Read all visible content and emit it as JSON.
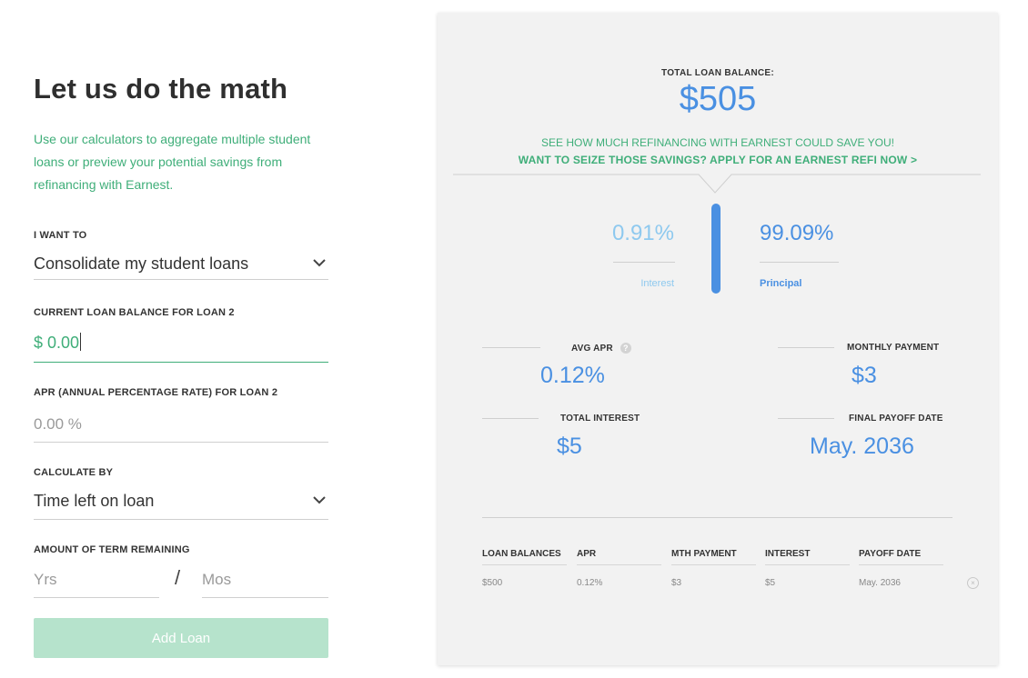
{
  "form": {
    "title": "Let us do the math",
    "intro": "Use our calculators to aggregate multiple student loans or preview your potential savings from refinancing with Earnest.",
    "i_want_to_label": "I WANT TO",
    "i_want_to_value": "Consolidate my student loans",
    "balance_label": "CURRENT LOAN BALANCE FOR LOAN 2",
    "balance_value": "$ 0.00",
    "apr_label": "APR (ANNUAL PERCENTAGE RATE) FOR LOAN 2",
    "apr_placeholder": "0.00 %",
    "calc_by_label": "CALCULATE BY",
    "calc_by_value": "Time left on loan",
    "term_label": "AMOUNT OF TERM REMAINING",
    "yrs_placeholder": "Yrs",
    "slash": "/",
    "mos_placeholder": "Mos",
    "add_button": "Add Loan"
  },
  "summary": {
    "total_label": "TOTAL LOAN BALANCE:",
    "total_value": "$505",
    "see_text": "SEE HOW MUCH REFINANCING WITH EARNEST COULD SAVE YOU!",
    "apply_text": "WANT TO SEIZE THOSE SAVINGS? APPLY FOR AN EARNEST REFI NOW >",
    "interest_pct": "0.91%",
    "principal_pct": "99.09%",
    "interest_fraction": 0.0091,
    "interest_label": "Interest",
    "principal_label": "Principal",
    "avg_apr_label": "AVG APR",
    "avg_apr_value": "0.12%",
    "monthly_label": "MONTHLY PAYMENT",
    "monthly_value": "$3",
    "total_interest_label": "TOTAL INTEREST",
    "total_interest_value": "$5",
    "payoff_label": "FINAL PAYOFF DATE",
    "payoff_value": "May. 2036",
    "help_icon": "?",
    "colors": {
      "accent_green": "#3fae79",
      "accent_blue": "#4a90e2",
      "light_blue": "#8ec9ef"
    }
  },
  "table": {
    "headers": [
      "LOAN BALANCES",
      "APR",
      "MTH PAYMENT",
      "INTEREST",
      "PAYOFF DATE"
    ],
    "rows": [
      [
        "$500",
        "0.12%",
        "$3",
        "$5",
        "May. 2036"
      ]
    ],
    "remove_icon": "×"
  }
}
